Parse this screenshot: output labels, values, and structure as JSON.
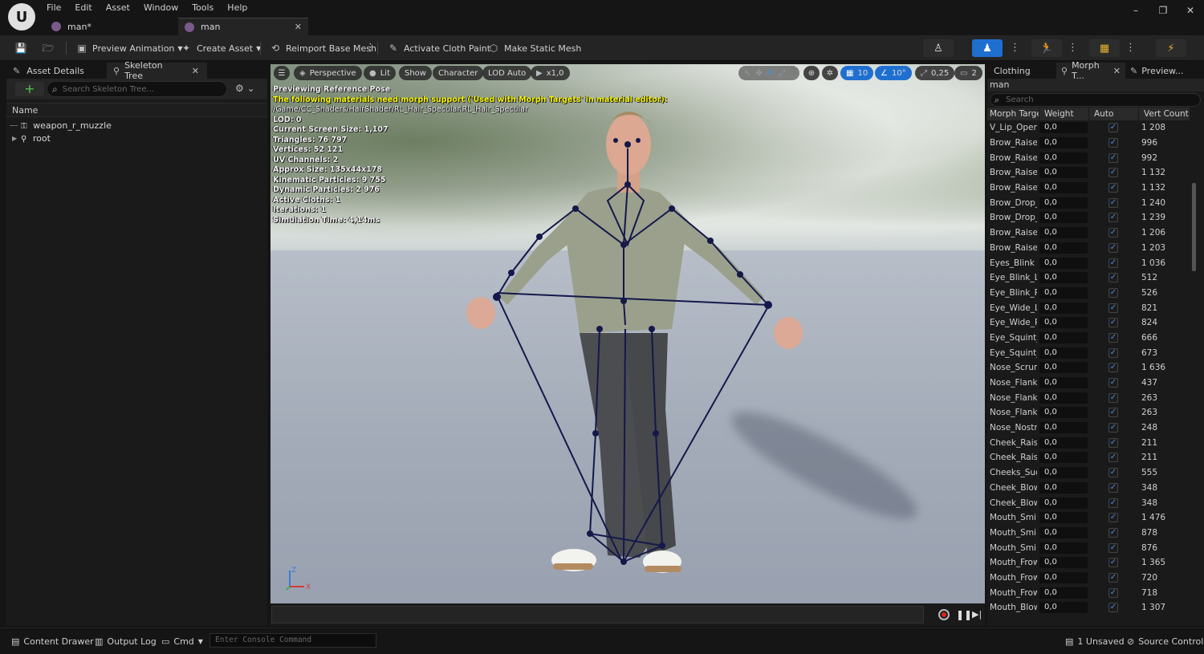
{
  "menu": [
    "File",
    "Edit",
    "Asset",
    "Window",
    "Tools",
    "Help"
  ],
  "doc_tabs": [
    {
      "label": "man*"
    },
    {
      "label": "man"
    }
  ],
  "window_controls": {
    "minimize": "–",
    "restore": "❐",
    "close": "✕"
  },
  "toolbar": {
    "preview_animation": "Preview Animation",
    "create_asset": "Create Asset",
    "reimport": "Reimport Base Mesh",
    "activate_cloth": "Activate Cloth Paint",
    "make_static": "Make Static Mesh"
  },
  "left_panel": {
    "tabs": [
      {
        "label": "Asset Details"
      },
      {
        "label": "Skeleton Tree"
      }
    ],
    "search_placeholder": "Search Skeleton Tree...",
    "column_name": "Name",
    "tree": [
      {
        "label": "weapon_r_muzzle"
      },
      {
        "label": "root"
      }
    ]
  },
  "viewport": {
    "buttons": {
      "perspective": "Perspective",
      "lit": "Lit",
      "show": "Show",
      "character": "Character",
      "lod": "LOD Auto",
      "speed": "x1,0"
    },
    "right_buttons": {
      "grid": "10",
      "angle": "10°",
      "scale": "0,25",
      "camera": "2"
    },
    "overlay": {
      "line1": "Previewing Reference Pose",
      "warning": "The following materials need morph support ('Used with Morph Targets' in material editor):",
      "path": "/Game/CC_Shaders/HairShader/RL_Hair_Specular.RL_Hair_Specular",
      "stats": [
        "LOD: 0",
        "Current Screen Size: 1,107",
        "Triangles: 76 797",
        "Vertices: 52 121",
        "UV Channels: 2",
        "Approx Size: 135x44x178",
        "Kinematic Particles: 9 755",
        "Dynamic Particles: 2 976",
        "Active Cloths: 1",
        "Iterations: 1",
        "Simulation Time: 4,14ms"
      ]
    },
    "axis": {
      "z": "Z",
      "x": "X"
    }
  },
  "right_panel": {
    "tabs": [
      {
        "label": "Clothing"
      },
      {
        "label": "Morph T..."
      },
      {
        "label": "Preview..."
      }
    ],
    "asset_name": "man",
    "search_placeholder": "Search",
    "columns": {
      "name": "Morph Targe",
      "weight": "Weight",
      "auto": "Auto",
      "vert": "Vert Count"
    },
    "rows": [
      {
        "name": "V_Lip_Open",
        "weight": "0,0",
        "vert": "1 208"
      },
      {
        "name": "Brow_Raise_In",
        "weight": "0,0",
        "vert": "996"
      },
      {
        "name": "Brow_Raise_In",
        "weight": "0,0",
        "vert": "992"
      },
      {
        "name": "Brow_Raise_O",
        "weight": "0,0",
        "vert": "1 132"
      },
      {
        "name": "Brow_Raise_O",
        "weight": "0,0",
        "vert": "1 132"
      },
      {
        "name": "Brow_Drop_Le",
        "weight": "0,0",
        "vert": "1 240"
      },
      {
        "name": "Brow_Drop_Ri",
        "weight": "0,0",
        "vert": "1 239"
      },
      {
        "name": "Brow_Raise_L",
        "weight": "0,0",
        "vert": "1 206"
      },
      {
        "name": "Brow_Raise_R",
        "weight": "0,0",
        "vert": "1 203"
      },
      {
        "name": "Eyes_Blink",
        "weight": "0,0",
        "vert": "1 036"
      },
      {
        "name": "Eye_Blink_L",
        "weight": "0,0",
        "vert": "512"
      },
      {
        "name": "Eye_Blink_R",
        "weight": "0,0",
        "vert": "526"
      },
      {
        "name": "Eye_Wide_L",
        "weight": "0,0",
        "vert": "821"
      },
      {
        "name": "Eye_Wide_R",
        "weight": "0,0",
        "vert": "824"
      },
      {
        "name": "Eye_Squint_L",
        "weight": "0,0",
        "vert": "666"
      },
      {
        "name": "Eye_Squint_R",
        "weight": "0,0",
        "vert": "673"
      },
      {
        "name": "Nose_Scrunch",
        "weight": "0,0",
        "vert": "1 636"
      },
      {
        "name": "Nose_Flanks_",
        "weight": "0,0",
        "vert": "437"
      },
      {
        "name": "Nose_Flank_R",
        "weight": "0,0",
        "vert": "263"
      },
      {
        "name": "Nose_Flank_R",
        "weight": "0,0",
        "vert": "263"
      },
      {
        "name": "Nose_Nostrils",
        "weight": "0,0",
        "vert": "248"
      },
      {
        "name": "Cheek_Raise_",
        "weight": "0,0",
        "vert": "211"
      },
      {
        "name": "Cheek_Raise_",
        "weight": "0,0",
        "vert": "211"
      },
      {
        "name": "Cheeks_Suck",
        "weight": "0,0",
        "vert": "555"
      },
      {
        "name": "Cheek_Blow_L",
        "weight": "0,0",
        "vert": "348"
      },
      {
        "name": "Cheek_Blow_R",
        "weight": "0,0",
        "vert": "348"
      },
      {
        "name": "Mouth_Smile",
        "weight": "0,0",
        "vert": "1 476"
      },
      {
        "name": "Mouth_Smile_",
        "weight": "0,0",
        "vert": "878"
      },
      {
        "name": "Mouth_Smile_",
        "weight": "0,0",
        "vert": "876"
      },
      {
        "name": "Mouth_Frown",
        "weight": "0,0",
        "vert": "1 365"
      },
      {
        "name": "Mouth_Frown_",
        "weight": "0,0",
        "vert": "720"
      },
      {
        "name": "Mouth_Frown_",
        "weight": "0,0",
        "vert": "718"
      },
      {
        "name": "Mouth_Blow",
        "weight": "0,0",
        "vert": "1 307"
      }
    ]
  },
  "status_bar": {
    "content_drawer": "Content Drawer",
    "output_log": "Output Log",
    "cmd": "Cmd",
    "console_placeholder": "Enter Console Command",
    "unsaved": "1 Unsaved",
    "source_control": "Source Control"
  }
}
